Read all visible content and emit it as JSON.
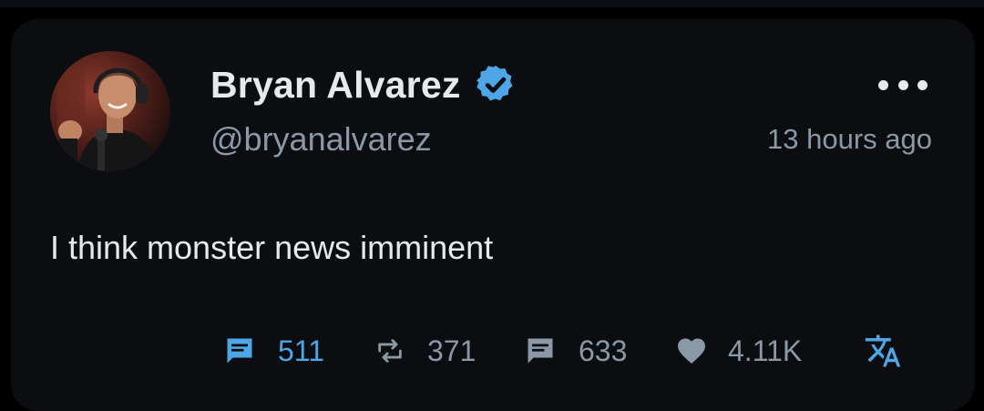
{
  "author": {
    "name": "Bryan Alvarez",
    "handle": "@bryanalvarez",
    "verified": true
  },
  "post": {
    "time": "13 hours ago",
    "text": "I think monster news imminent"
  },
  "stats": {
    "replies": "511",
    "reposts": "371",
    "quotes": "633",
    "likes": "4.11K"
  },
  "icons": {
    "more": "more-horizontal-icon",
    "verified": "verified-badge-icon",
    "replies": "comment-icon",
    "reposts": "repost-icon",
    "quotes": "quote-icon",
    "likes": "heart-icon",
    "translate": "translate-icon"
  },
  "colors": {
    "background": "#0b0d10",
    "primary_text": "#e7e9ea",
    "secondary_text": "#8b98a5",
    "accent": "#4ea6e6",
    "verified": "#4ea6e6"
  }
}
